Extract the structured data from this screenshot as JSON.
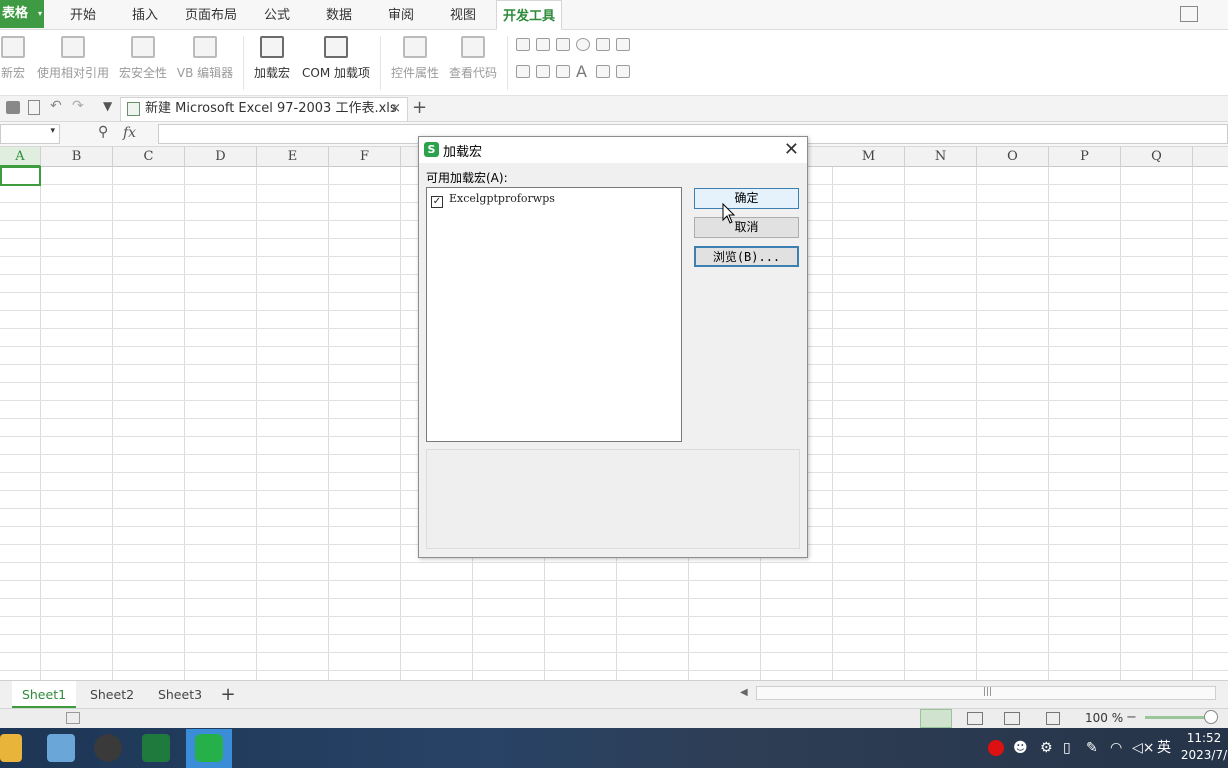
{
  "app": {
    "name": "表格"
  },
  "menu_tabs": [
    "开始",
    "插入",
    "页面布局",
    "公式",
    "数据",
    "审阅",
    "视图",
    "开发工具"
  ],
  "active_tab": "开发工具",
  "ribbon": {
    "buttons": [
      "新宏",
      "使用相对引用",
      "宏安全性",
      "VB 编辑器",
      "加载宏",
      "COM 加载项",
      "控件属性",
      "查看代码"
    ]
  },
  "document_tab": {
    "title": "新建 Microsoft Excel 97-2003 工作表.xls",
    "close": "×",
    "add": "+"
  },
  "formula_bar": {
    "fx": "fx"
  },
  "columns": [
    "A",
    "B",
    "C",
    "D",
    "E",
    "F",
    "M",
    "N",
    "O",
    "P",
    "Q"
  ],
  "sheets": [
    "Sheet1",
    "Sheet2",
    "Sheet3"
  ],
  "active_sheet": "Sheet1",
  "status": {
    "zoom": "100 %"
  },
  "taskbar": {
    "time": "11:52",
    "date": "2023/7/",
    "ime": "英"
  },
  "dialog": {
    "title": "加载宏",
    "close": "✕",
    "available_label": "可用加载宏(A):",
    "addins": [
      {
        "name": "Excelgptproforwps",
        "checked": true
      }
    ],
    "ok": "确定",
    "cancel": "取消",
    "browse": "浏览(B)..."
  },
  "colors": {
    "accent": "#3d9c3d",
    "dialog_bg": "#f0f0f0",
    "button_focus": "#3c7fb1"
  }
}
